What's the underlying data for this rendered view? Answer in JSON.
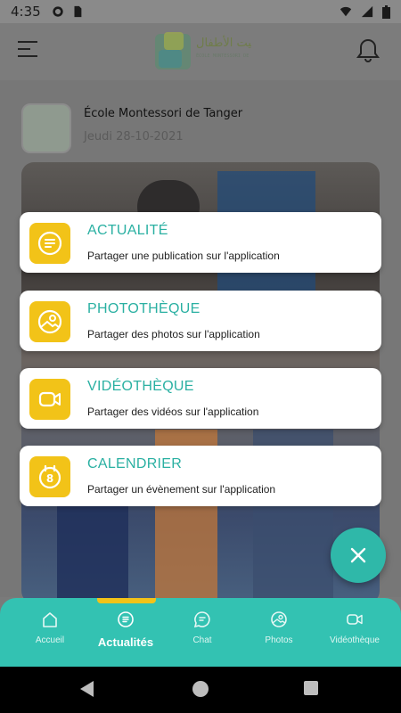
{
  "status_bar": {
    "time": "4:35"
  },
  "header": {
    "logo_text_arabic": "بيت الأطفال",
    "logo_text_latin": "ÉCOLE MONTESSORI DE TANGER"
  },
  "post": {
    "school": "École Montessori de Tanger",
    "date": "Jeudi 28-10-2021"
  },
  "actions": [
    {
      "title": "ACTUALITÉ",
      "description": "Partager une publication sur l'application",
      "icon": "news-icon"
    },
    {
      "title": "PHOTOTHÈQUE",
      "description": "Partager des photos sur l'application",
      "icon": "image-icon"
    },
    {
      "title": "VIDÉOTHÈQUE",
      "description": "Partager des vidéos sur l'application",
      "icon": "video-icon"
    },
    {
      "title": "CALENDRIER",
      "description": "Partager un évènement sur l'application",
      "icon": "calendar-icon",
      "icon_badge": "8"
    }
  ],
  "fab": {
    "icon": "close-icon"
  },
  "bottom_nav": {
    "items": [
      {
        "label": "Accueil",
        "icon": "home-icon"
      },
      {
        "label": "Actualités",
        "icon": "news-icon"
      },
      {
        "label": "Chat",
        "icon": "chat-icon"
      },
      {
        "label": "Photos",
        "icon": "image-icon"
      },
      {
        "label": "Vidéothèque",
        "icon": "video-icon"
      }
    ],
    "active_index": 1
  },
  "colors": {
    "accent_teal": "#33c2b2",
    "accent_yellow": "#f2c318",
    "title_teal": "#2ab0a2"
  }
}
